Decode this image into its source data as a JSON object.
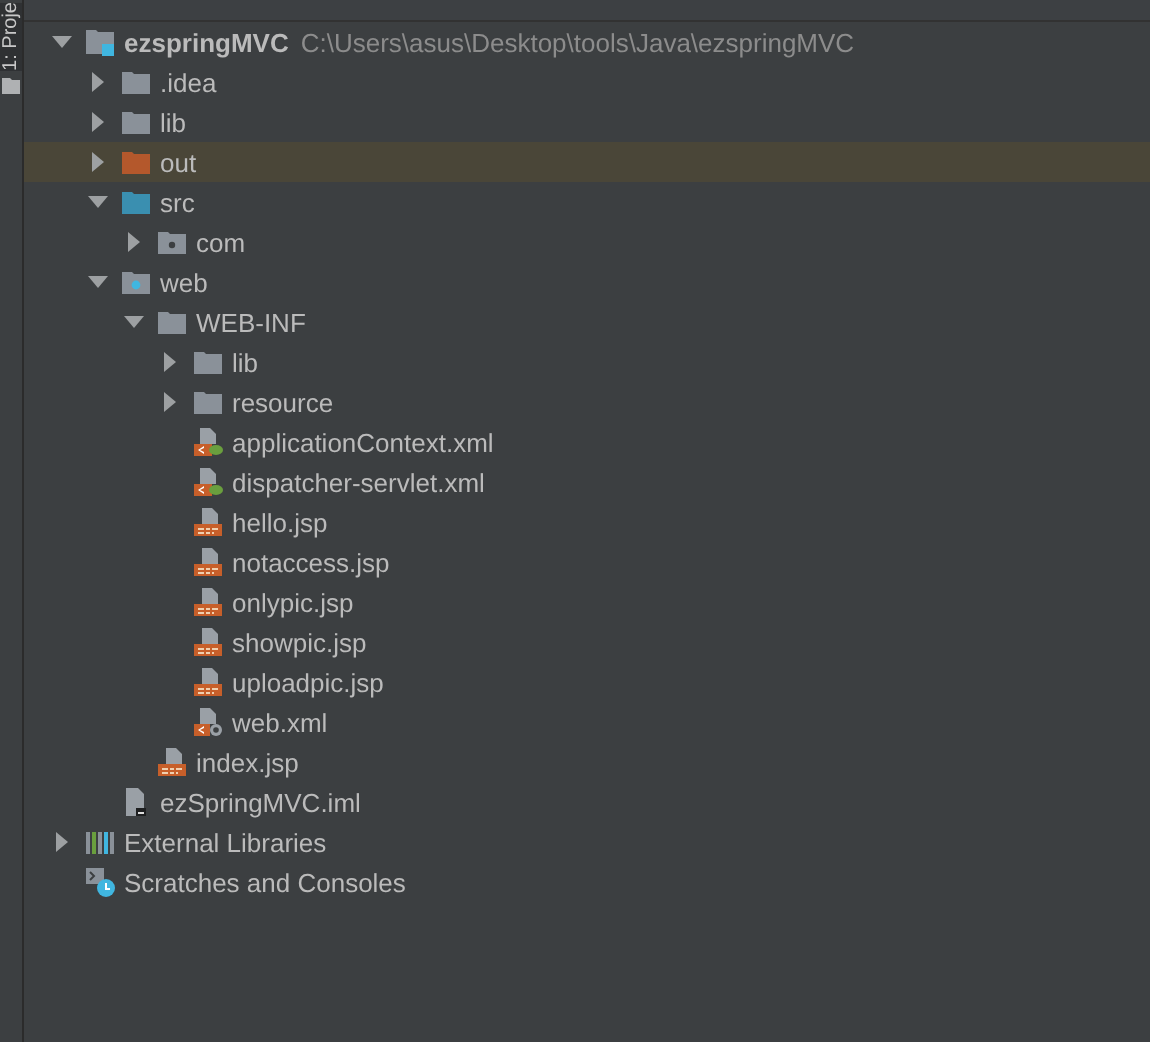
{
  "side_tab": {
    "label": "1: Proje",
    "selected": true
  },
  "tree": [
    {
      "label": "ezspringMVC",
      "path": "C:\\Users\\asus\\Desktop\\tools\\Java\\ezspringMVC",
      "kind": "module",
      "expanded": true,
      "selected": false,
      "children": [
        {
          "label": ".idea",
          "kind": "folder",
          "expanded": false,
          "selected": false
        },
        {
          "label": "lib",
          "kind": "folder",
          "expanded": false,
          "selected": false
        },
        {
          "label": "out",
          "kind": "excluded-folder",
          "expanded": false,
          "selected": true
        },
        {
          "label": "src",
          "kind": "source-folder",
          "expanded": true,
          "selected": false,
          "children": [
            {
              "label": "com",
              "kind": "package",
              "expanded": false,
              "selected": false
            }
          ]
        },
        {
          "label": "web",
          "kind": "web-folder",
          "expanded": true,
          "selected": false,
          "children": [
            {
              "label": "WEB-INF",
              "kind": "folder",
              "expanded": true,
              "selected": false,
              "children": [
                {
                  "label": "lib",
                  "kind": "folder",
                  "expanded": false,
                  "selected": false
                },
                {
                  "label": "resource",
                  "kind": "folder",
                  "expanded": false,
                  "selected": false
                },
                {
                  "label": "applicationContext.xml",
                  "kind": "spring-xml",
                  "selected": false
                },
                {
                  "label": "dispatcher-servlet.xml",
                  "kind": "spring-xml",
                  "selected": false
                },
                {
                  "label": "hello.jsp",
                  "kind": "jsp",
                  "selected": false
                },
                {
                  "label": "notaccess.jsp",
                  "kind": "jsp",
                  "selected": false
                },
                {
                  "label": "onlypic.jsp",
                  "kind": "jsp",
                  "selected": false
                },
                {
                  "label": "showpic.jsp",
                  "kind": "jsp",
                  "selected": false
                },
                {
                  "label": "uploadpic.jsp",
                  "kind": "jsp",
                  "selected": false
                },
                {
                  "label": "web.xml",
                  "kind": "web-xml",
                  "selected": false
                }
              ]
            },
            {
              "label": "index.jsp",
              "kind": "jsp",
              "selected": false
            }
          ]
        },
        {
          "label": "ezSpringMVC.iml",
          "kind": "iml",
          "selected": false
        }
      ]
    },
    {
      "label": "External Libraries",
      "kind": "libraries",
      "expanded": false,
      "selected": false
    },
    {
      "label": "Scratches and Consoles",
      "kind": "scratches",
      "selected": false
    }
  ]
}
